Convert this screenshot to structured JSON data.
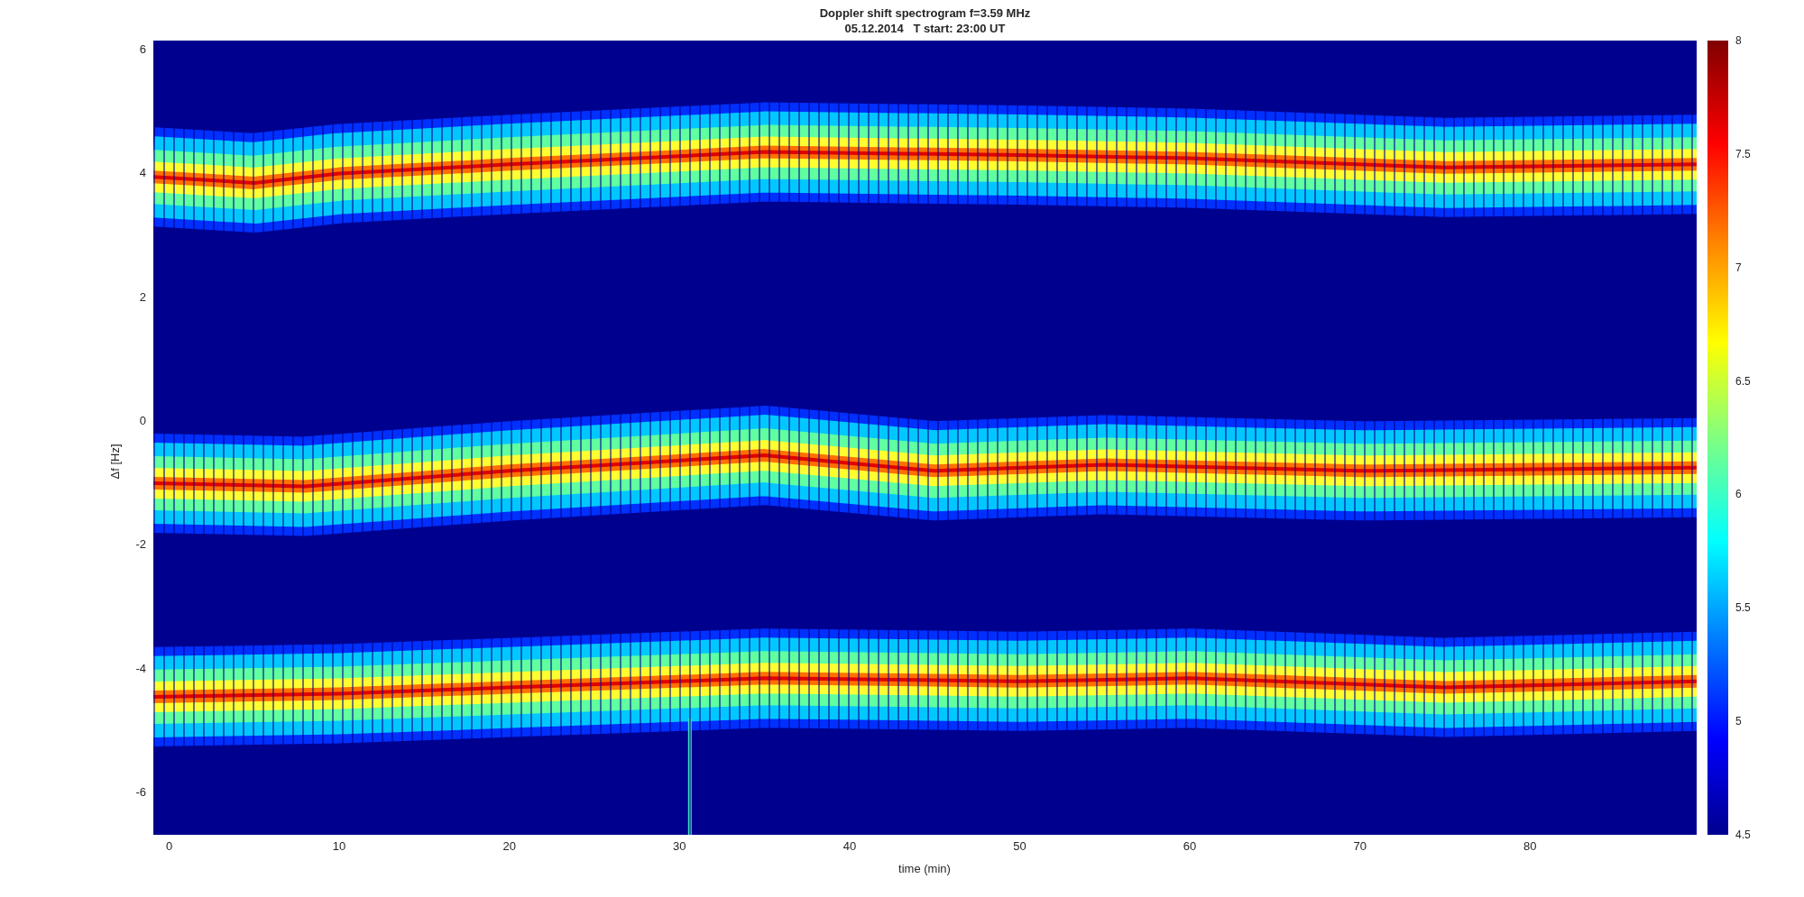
{
  "title": "Doppler shift spectrogram f=3.59 MHz",
  "subtitle": "05.12.2014   T start: 23:00 UT",
  "y_axis": {
    "label": "Δf [Hz]",
    "ticks": [
      "6",
      "4",
      "2",
      "0",
      "-2",
      "-4",
      "-6"
    ]
  },
  "x_axis": {
    "label": "time (min)",
    "ticks": [
      "0",
      "10",
      "20",
      "30",
      "40",
      "50",
      "60",
      "70",
      "80"
    ]
  },
  "colorbar": {
    "ticks": [
      "8",
      "7.5",
      "7",
      "6.5",
      "6",
      "5.5",
      "5",
      "4.5"
    ]
  }
}
